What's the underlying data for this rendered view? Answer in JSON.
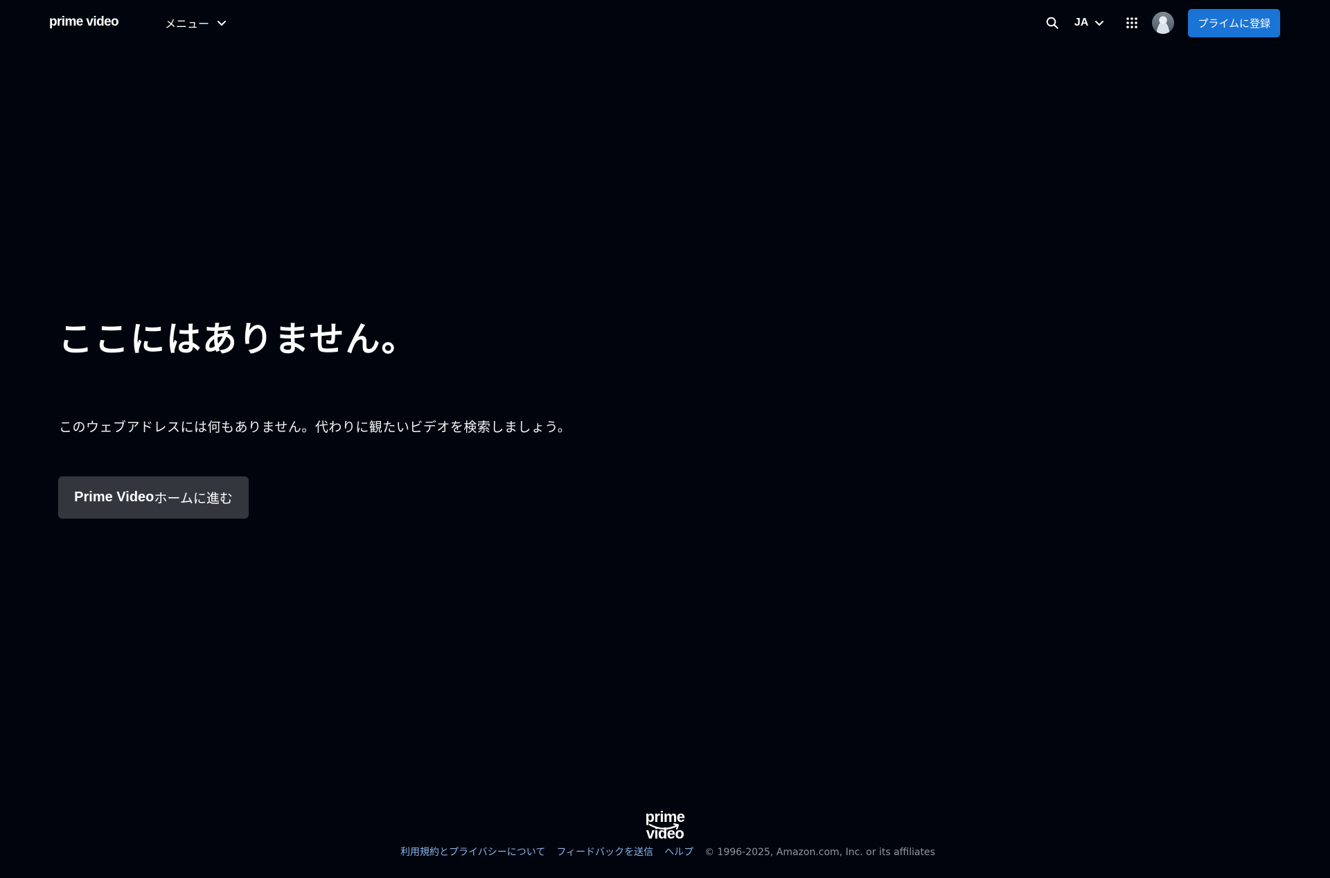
{
  "header": {
    "logo": "prime video",
    "menu_label": "メニュー",
    "language": "JA",
    "signup_label": "プライムに登録"
  },
  "main": {
    "title": "ここにはありません。",
    "description": "このウェブアドレスには何もありません。代わりに観たいビデオを検索しましょう。",
    "home_button_prefix": "Prime Video",
    "home_button_suffix": "ホームに進む"
  },
  "footer": {
    "logo": "prime video",
    "links": [
      "利用規約とプライバシーについて",
      "フィードバックを送信",
      "ヘルプ"
    ],
    "copyright": "© 1996-2025, Amazon.com, Inc. or its affiliates"
  },
  "colors": {
    "background": "#00050d",
    "accent": "#1a74d6",
    "button_secondary": "#33373d",
    "footer_link": "#8ab4ea"
  },
  "icons": [
    "search-icon",
    "chevron-down-icon",
    "apps-grid-icon",
    "avatar",
    "amazon-smile-icon"
  ]
}
